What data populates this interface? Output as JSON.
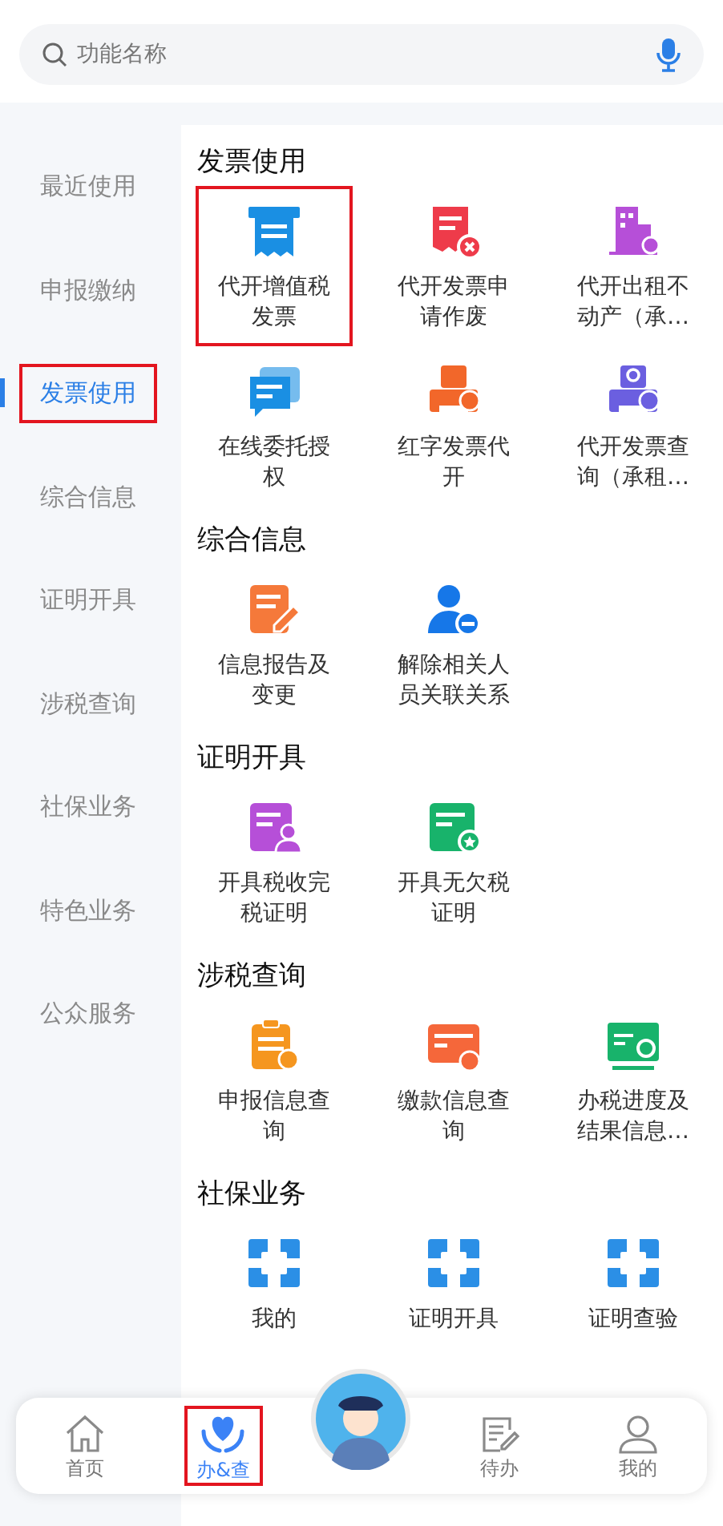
{
  "search": {
    "placeholder": "功能名称"
  },
  "sidebar": {
    "items": [
      {
        "label": "最近使用",
        "selected": false,
        "highlighted": false
      },
      {
        "label": "申报缴纳",
        "selected": false,
        "highlighted": false
      },
      {
        "label": "发票使用",
        "selected": true,
        "highlighted": true
      },
      {
        "label": "综合信息",
        "selected": false,
        "highlighted": false
      },
      {
        "label": "证明开具",
        "selected": false,
        "highlighted": false
      },
      {
        "label": "涉税查询",
        "selected": false,
        "highlighted": false
      },
      {
        "label": "社保业务",
        "selected": false,
        "highlighted": false
      },
      {
        "label": "特色业务",
        "selected": false,
        "highlighted": false
      },
      {
        "label": "公众服务",
        "selected": false,
        "highlighted": false
      }
    ]
  },
  "sections": [
    {
      "title": "发票使用",
      "items": [
        {
          "label": "代开增值税发票",
          "kind": "receipt",
          "color": "#1a8fe3",
          "highlighted": true
        },
        {
          "label": "代开发票申请作废",
          "kind": "doc-x",
          "color": "#ee3b4a",
          "highlighted": false
        },
        {
          "label": "代开出租不动产（承…",
          "kind": "building",
          "color": "#b64fd8",
          "highlighted": false
        },
        {
          "label": "在线委托授权",
          "kind": "chat",
          "color": "#1a8fe3",
          "highlighted": false
        },
        {
          "label": "红字发票代开",
          "kind": "printer",
          "color": "#f2672a",
          "highlighted": false
        },
        {
          "label": "代开发票查询（承租…",
          "kind": "printer-search",
          "color": "#6b5fe0",
          "highlighted": false
        }
      ]
    },
    {
      "title": "综合信息",
      "items": [
        {
          "label": "信息报告及变更",
          "kind": "doc-pen",
          "color": "#f5793a",
          "highlighted": false
        },
        {
          "label": "解除相关人员关联关系",
          "kind": "user-minus",
          "color": "#1677e8",
          "highlighted": false
        }
      ]
    },
    {
      "title": "证明开具",
      "items": [
        {
          "label": "开具税收完税证明",
          "kind": "doc-user",
          "color": "#b64fd8",
          "highlighted": false
        },
        {
          "label": "开具无欠税证明",
          "kind": "doc-star",
          "color": "#18b36b",
          "highlighted": false
        }
      ]
    },
    {
      "title": "涉税查询",
      "items": [
        {
          "label": "申报信息查询",
          "kind": "clipboard-search",
          "color": "#f5961f",
          "highlighted": false
        },
        {
          "label": "缴款信息查询",
          "kind": "card-search",
          "color": "#f5673a",
          "highlighted": false
        },
        {
          "label": "办税进度及结果信息…",
          "kind": "screen-search",
          "color": "#18b36b",
          "highlighted": false
        }
      ]
    },
    {
      "title": "社保业务",
      "items": [
        {
          "label": "我的",
          "kind": "frame",
          "color": "#2b8fe6",
          "highlighted": false
        },
        {
          "label": "证明开具",
          "kind": "frame",
          "color": "#2b8fe6",
          "highlighted": false
        },
        {
          "label": "证明查验",
          "kind": "frame",
          "color": "#2b8fe6",
          "highlighted": false
        }
      ]
    }
  ],
  "bottom_nav": [
    {
      "label": "首页",
      "kind": "home",
      "selected": false,
      "highlighted": false
    },
    {
      "label": "办&查",
      "kind": "heart-hands",
      "selected": true,
      "highlighted": true
    },
    {
      "label": "待办",
      "kind": "todo",
      "selected": false,
      "highlighted": false
    },
    {
      "label": "我的",
      "kind": "person",
      "selected": false,
      "highlighted": false
    }
  ]
}
